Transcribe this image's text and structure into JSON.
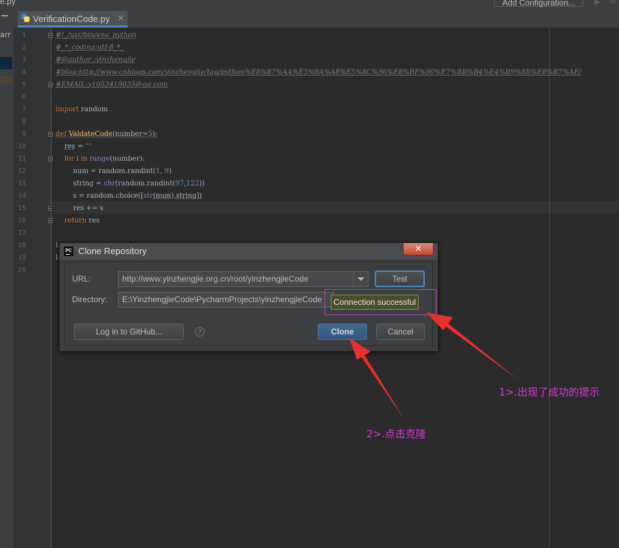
{
  "window": {
    "partial_filename": "e.py",
    "add_configuration": "Add Configuration...",
    "left_panel_text": "arr"
  },
  "tab": {
    "label": "VerificationCode.py",
    "close": "×"
  },
  "editor": {
    "line_numbers": [
      "1",
      "2",
      "3",
      "4",
      "5",
      "6",
      "7",
      "8",
      "9",
      "10",
      "11",
      "12",
      "13",
      "14",
      "15",
      "16",
      "17",
      "18",
      "19",
      "20"
    ],
    "lines": {
      "l1": "#!_/usr/bin/env_python",
      "l2": "#_*_coding:utf-8_*_",
      "l3": "#@author :yinzhengjie",
      "l4": "#blog:http://www.cnblogs.com/yinzhengjie/tag/python%E8%87%AA%E5%8A%A8%E5%8C%96%E8%BF%90%E7%BB%B4%E4%B9%8B%E8%B7%AF/",
      "l5": "#EMAIL:y1053419035@qq.com",
      "l7_import": "import",
      "l7_mod": " random",
      "l9_def": "def",
      "l9_name": "ValdateCode",
      "l9_args_open": "(number=",
      "l9_num": "5",
      "l9_args_close": "):",
      "l10_var": "res",
      "l10_eq": " = ",
      "l10_str": "\"\"",
      "l11_for": "for",
      "l11_i": " i ",
      "l11_in": "in",
      "l11_range": " range",
      "l11_rest": "(number):",
      "l12_a": "num = random.randint(",
      "l12_n1": "1",
      "l12_sep": ", ",
      "l12_n2": "9",
      "l12_end": ")",
      "l13_a": "string = ",
      "l13_chr": "chr",
      "l13_b": "(random.randint(",
      "l13_n1": "97",
      "l13_sep": ",",
      "l13_n2": "122",
      "l13_end": "))",
      "l14_a": "s = random.choice([",
      "l14_str": "str",
      "l14_b": "(num),string])",
      "l15": "res += s",
      "l16_ret": "return",
      "l16_rest": " res",
      "l18_partial": "i",
      "l19_partial": "l"
    }
  },
  "dialog": {
    "title": "Clone Repository",
    "app_icon": "PC",
    "close": "✕",
    "url_label": "URL:",
    "url_value": "http://www.yinzhengjie.org.cn/root/yinzhengjieCode",
    "test_button": "Test",
    "directory_label": "Directory:",
    "directory_value": "E:\\YinzhengjieCode\\PycharmProjects\\yinzhengjieCode",
    "github_button": "Log in to GitHub...",
    "help": "?",
    "clone_button": "Clone",
    "cancel_button": "Cancel",
    "tooltip": "Connection successful"
  },
  "annotations": {
    "note1": "1>.出现了成功的提示",
    "note2": "2>.点击克隆",
    "color": "#d838d8"
  }
}
